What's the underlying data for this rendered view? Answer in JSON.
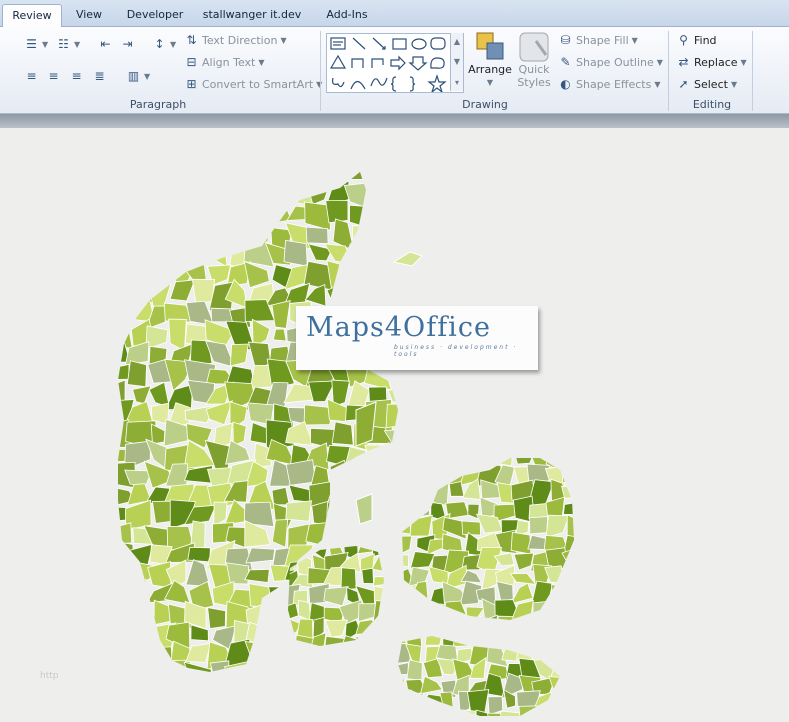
{
  "tabs": [
    {
      "label": "Review",
      "active": true
    },
    {
      "label": "View"
    },
    {
      "label": "Developer"
    },
    {
      "label": "stallwanger it.dev"
    },
    {
      "label": "Add-Ins"
    }
  ],
  "ribbon": {
    "paragraph": {
      "label": "Paragraph",
      "text_direction": "Text Direction",
      "align_text": "Align Text",
      "convert_smartart": "Convert to SmartArt"
    },
    "drawing": {
      "label": "Drawing",
      "arrange": "Arrange",
      "quick": "Quick",
      "styles": "Styles",
      "shape_fill": "Shape Fill",
      "shape_outline": "Shape Outline",
      "shape_effects": "Shape Effects"
    },
    "editing": {
      "label": "Editing",
      "find": "Find",
      "replace": "Replace",
      "select": "Select"
    }
  },
  "logo": {
    "main": "Maps4Office",
    "tagline": "business · development · tools"
  },
  "footer": "http",
  "colors": {
    "map_shades": [
      "#9cbb3c",
      "#b8d155",
      "#c9dd6a",
      "#a7c24a",
      "#8dad35",
      "#d5e596",
      "#7f9f2e",
      "#bccf88",
      "#e0ea9f",
      "#6f9a1f",
      "#5f8c18",
      "#a9b887"
    ]
  }
}
